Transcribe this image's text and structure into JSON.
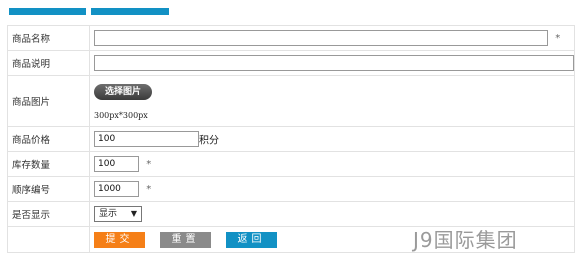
{
  "tabs": [
    {
      "label": ""
    },
    {
      "label": ""
    }
  ],
  "form": {
    "name": {
      "label": "商品名称",
      "value": "",
      "required_mark": "*"
    },
    "desc": {
      "label": "商品说明",
      "value": ""
    },
    "image": {
      "label": "商品图片",
      "button": "选择图片",
      "note": "300px*300px"
    },
    "price": {
      "label": "商品价格",
      "value": "100",
      "unit": "积分"
    },
    "stock": {
      "label": "库存数量",
      "value": "100",
      "required_mark": "*"
    },
    "order": {
      "label": "顺序编号",
      "value": "1000",
      "required_mark": "*"
    },
    "show": {
      "label": "是否显示",
      "selected": "显示"
    }
  },
  "actions": {
    "submit": "提交",
    "reset": "重置",
    "back": "返回"
  },
  "watermark": "J9国际集团",
  "colors": {
    "tab": "#1291c4",
    "submit": "#f57f17",
    "reset": "#8a8a8a",
    "back": "#1291c4"
  }
}
